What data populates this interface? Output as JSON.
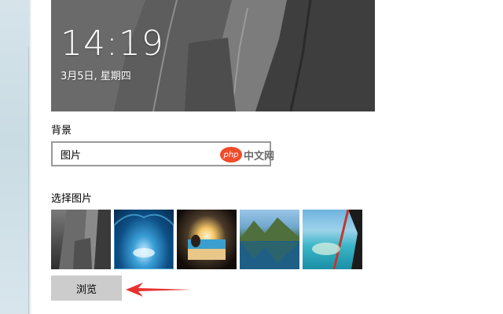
{
  "preview": {
    "time": "14:19",
    "date": "3月5日, 星期四"
  },
  "background": {
    "label": "背景",
    "selected": "图片"
  },
  "watermark": {
    "logo": "php",
    "text": "中文网"
  },
  "choose_picture": {
    "label": "选择图片",
    "thumbnails": [
      {
        "name": "cliff-rock"
      },
      {
        "name": "ice-cave"
      },
      {
        "name": "sea-cave-beach"
      },
      {
        "name": "mountain-lake"
      },
      {
        "name": "tropical-coast-aerial"
      }
    ]
  },
  "browse_button": {
    "label": "浏览"
  },
  "annotation": {
    "arrow_color": "#e8312f"
  }
}
